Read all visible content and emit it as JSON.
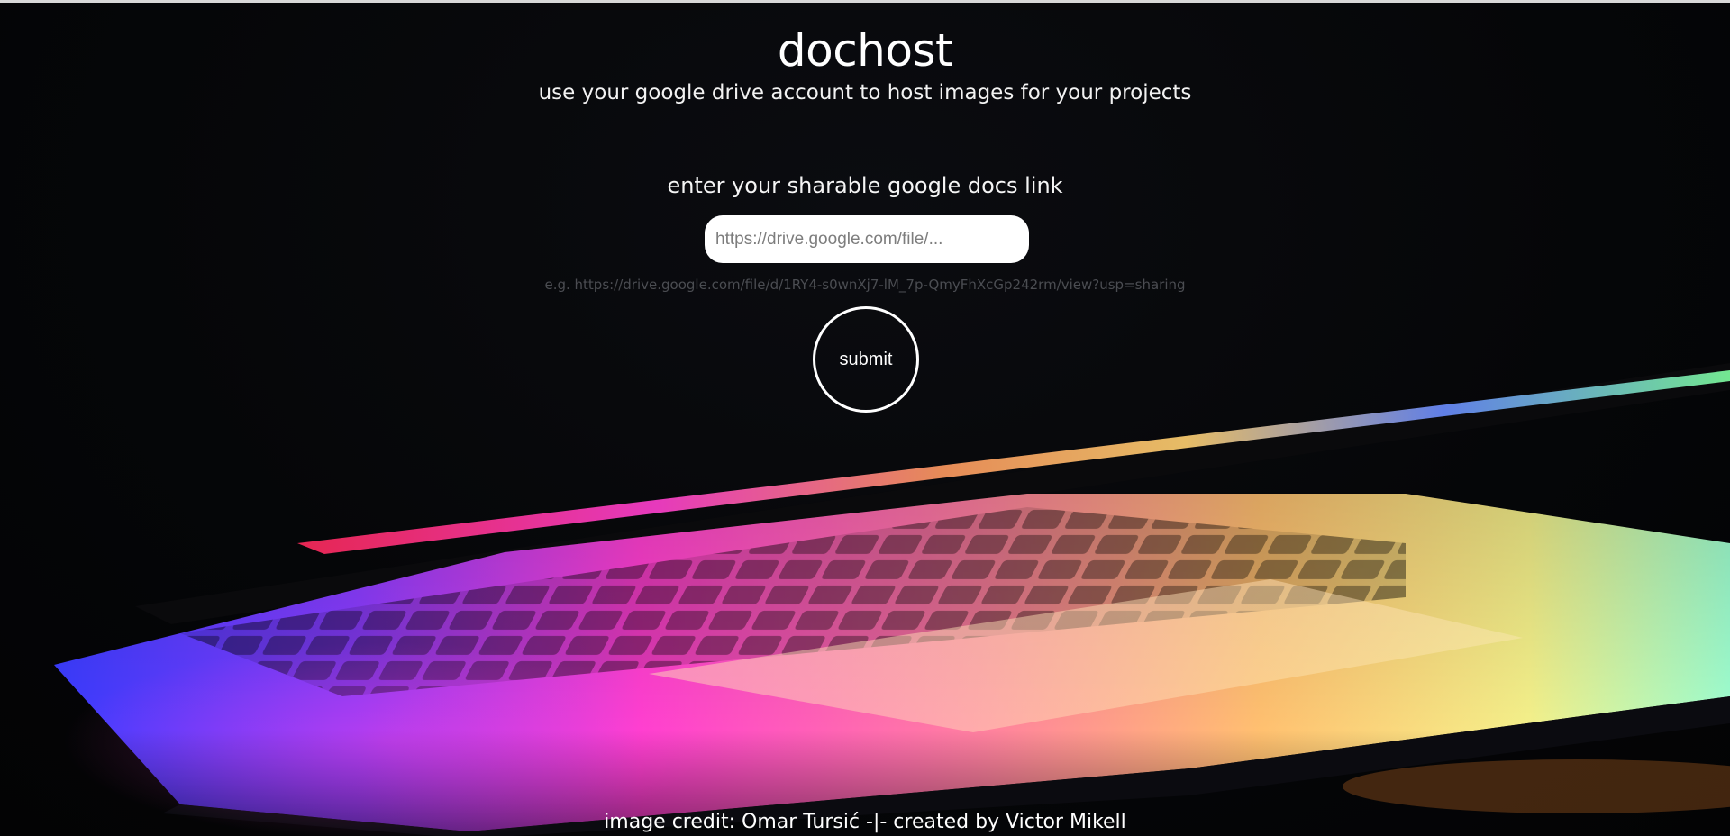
{
  "header": {
    "title": "dochost",
    "subtitle": "use your google drive account to host images for your projects"
  },
  "form": {
    "label": "enter your sharable google docs link",
    "input_placeholder": "https://drive.google.com/file/...",
    "input_value": "",
    "example": "e.g. https://drive.google.com/file/d/1RY4-s0wnXj7-lM_7p-QmyFhXcGp242rm/view?usp=sharing",
    "submit_label": "submit"
  },
  "footer": {
    "credit": "image credit: Omar Tursić -|- created by Victor Mikell"
  },
  "background": {
    "subject": "laptop-with-rainbow-backlit-keyboard",
    "colors": {
      "base": "#050608",
      "blue": "#2a6bff",
      "magenta": "#ff3fd0",
      "pink": "#ff6fa8",
      "orange": "#ffb04a",
      "yellow": "#f4f08a",
      "green": "#8cff9a"
    }
  }
}
